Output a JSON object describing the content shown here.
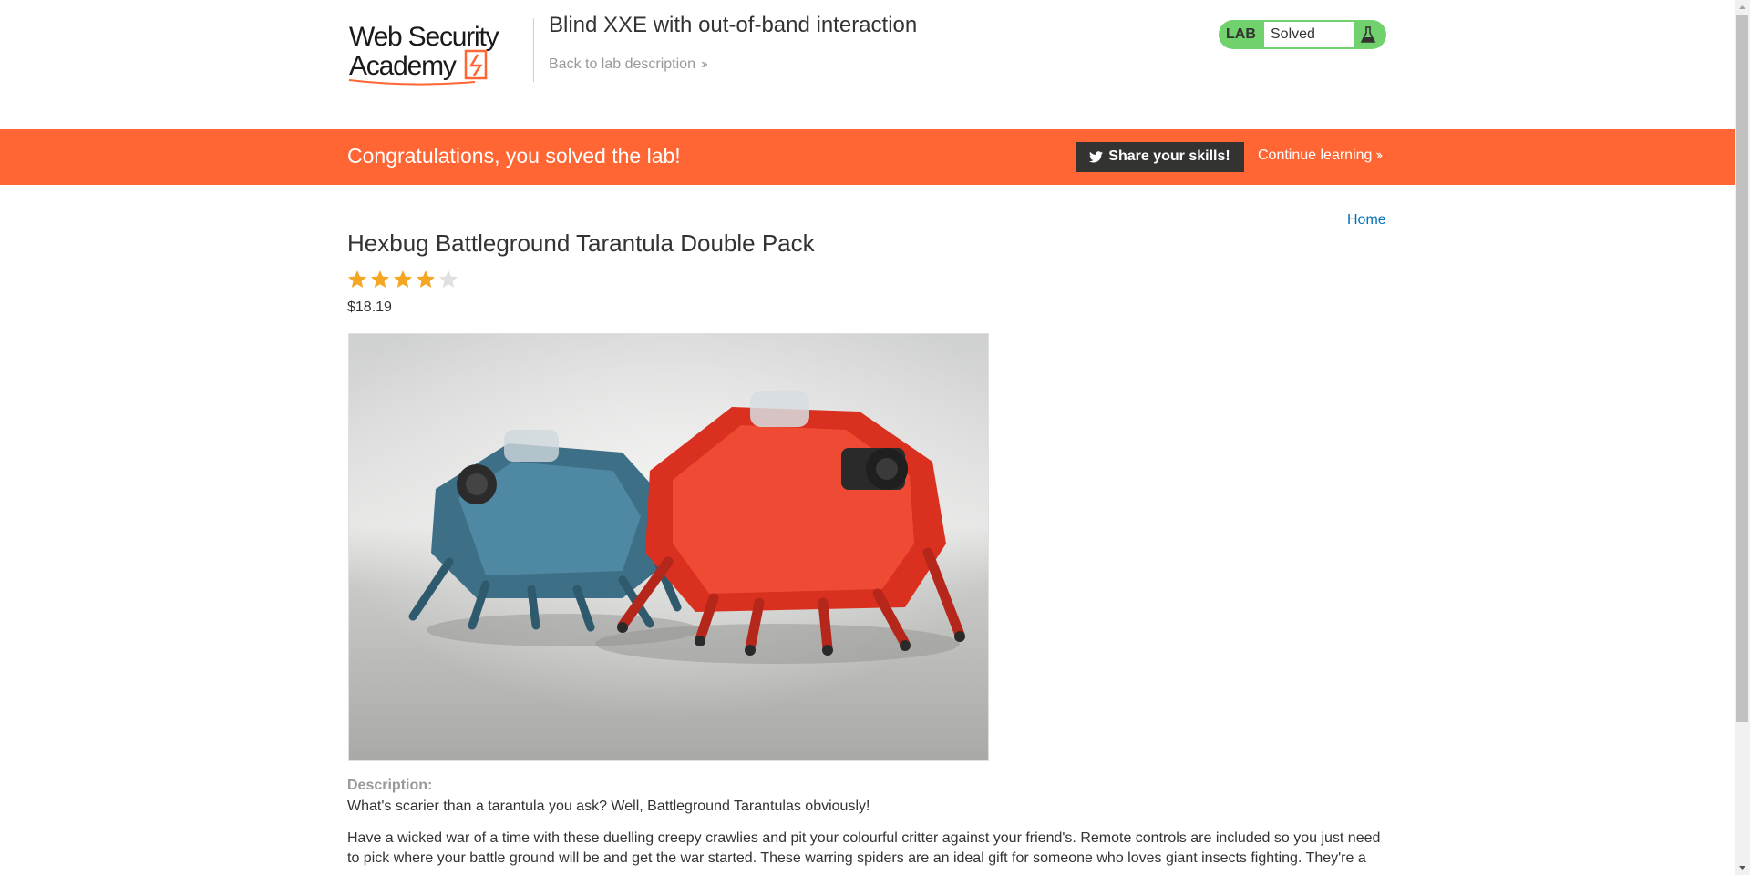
{
  "header": {
    "logo_text": "Web Security Academy",
    "lab_title": "Blind XXE with out-of-band interaction",
    "back_link": "Back to lab description",
    "lab_badge_label": "LAB",
    "lab_status": "Solved"
  },
  "banner": {
    "message": "Congratulations, you solved the lab!",
    "share_button": "Share your skills!",
    "continue_link": "Continue learning"
  },
  "nav": {
    "home_link": "Home"
  },
  "product": {
    "title": "Hexbug Battleground Tarantula Double Pack",
    "rating": 4,
    "rating_max": 5,
    "price": "$18.19",
    "description_label": "Description:",
    "description_intro": "What's scarier than a tarantula you ask? Well, Battleground Tarantulas obviously!",
    "description_body": "Have a wicked war of a time with these duelling creepy crawlies and pit your colourful critter against your friend's. Remote controls are included so you just need to pick where your battle ground will be and get the war started. These warring spiders are an ideal gift for someone who loves giant insects fighting. They're a"
  },
  "colors": {
    "accent_orange": "#ff6633",
    "solved_green": "#70d16d",
    "link_blue": "#0071bc",
    "star_gold": "#f5a623",
    "star_empty": "#e0e0e0"
  },
  "icons": {
    "flask": "flask-icon",
    "twitter": "twitter-icon",
    "chevrons": "double-chevron-right-icon",
    "star": "star-icon"
  }
}
